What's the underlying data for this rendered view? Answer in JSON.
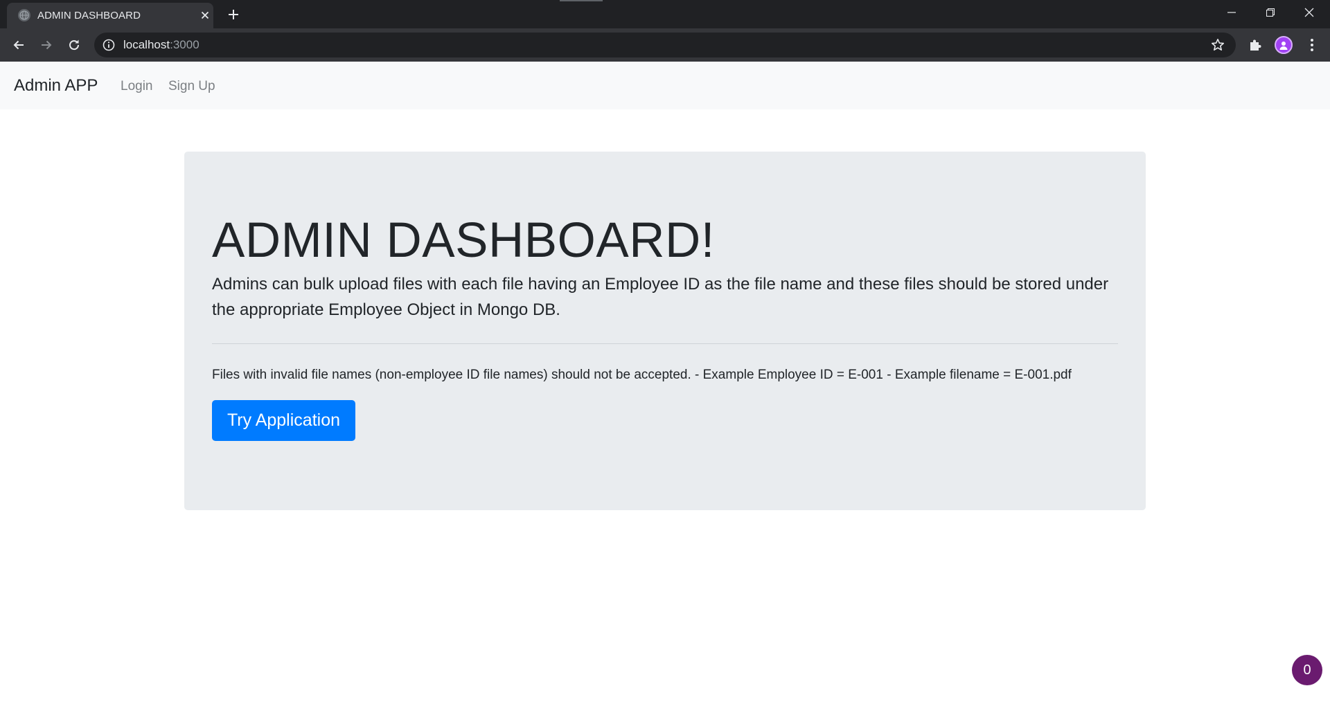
{
  "browser": {
    "tab": {
      "title": "ADMIN DASHBOARD"
    },
    "address_bar": {
      "host": "localhost",
      "port": ":3000"
    }
  },
  "navbar": {
    "brand": "Admin APP",
    "links": [
      {
        "label": "Login"
      },
      {
        "label": "Sign Up"
      }
    ]
  },
  "jumbotron": {
    "title": "ADMIN DASHBOARD!",
    "lead": "Admins can bulk upload files with each file having an Employee ID as the file name and these files should be stored under the appropriate Employee Object in Mongo DB.",
    "body": "Files with invalid file names (non-employee ID file names) should not be accepted. - Example Employee ID = E-001 - Example filename = E-001.pdf",
    "button_label": "Try Application"
  },
  "badge": {
    "count": "0"
  },
  "colors": {
    "primary": "#007bff",
    "jumbotron_bg": "#e9ecef",
    "navbar_bg": "#f8f9fa",
    "badge": "#6a1b6f"
  }
}
